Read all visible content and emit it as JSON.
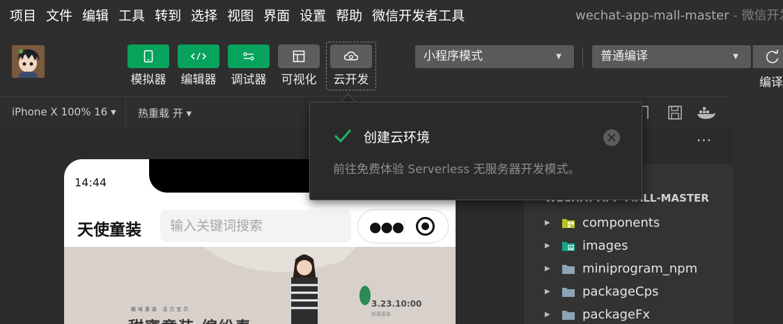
{
  "menu": [
    "项目",
    "文件",
    "编辑",
    "工具",
    "转到",
    "选择",
    "视图",
    "界面",
    "设置",
    "帮助",
    "微信开发者工具"
  ],
  "window": {
    "title": "wechat-app-mall-master",
    "subtitle": " - 微信开发"
  },
  "toolbar": {
    "tools": [
      {
        "label": "模拟器",
        "icon": "phone-icon"
      },
      {
        "label": "编辑器",
        "icon": "code-icon"
      },
      {
        "label": "调试器",
        "icon": "debug-icon"
      },
      {
        "label": "可视化",
        "icon": "layout-icon"
      },
      {
        "label": "云开发",
        "icon": "cloud-icon"
      }
    ],
    "mode_select": "小程序模式",
    "compile_select": "普通编译",
    "compile_label": "编译"
  },
  "simulator": {
    "device": "iPhone X 100% 16 ▾",
    "hot_reload": "热重载 开 ▾"
  },
  "phone": {
    "time": "14:44",
    "brand": "天使童装",
    "search_placeholder": "输入关键词搜索",
    "banner_date": "3.23.10:00",
    "banner_small": "新春童装",
    "banner_tag": "趣味童装 活力宝贝",
    "banner_big": "甜蜜童装 缤纷春"
  },
  "popup": {
    "title": "创建云环境",
    "description": "前往免费体验 Serverless 无服务器开发模式。"
  },
  "explorer": {
    "more": "···",
    "project": "WECHAT-APP-MALL-MASTER",
    "items": [
      {
        "name": "components",
        "icon": "components-folder-icon"
      },
      {
        "name": "images",
        "icon": "images-folder-icon"
      },
      {
        "name": "miniprogram_npm",
        "icon": "folder-icon"
      },
      {
        "name": "packageCps",
        "icon": "folder-icon"
      },
      {
        "name": "packageFx",
        "icon": "folder-icon"
      }
    ]
  },
  "colors": {
    "accent": "#07a25b",
    "check": "#1fb56b",
    "background": "#2b2b2b"
  }
}
